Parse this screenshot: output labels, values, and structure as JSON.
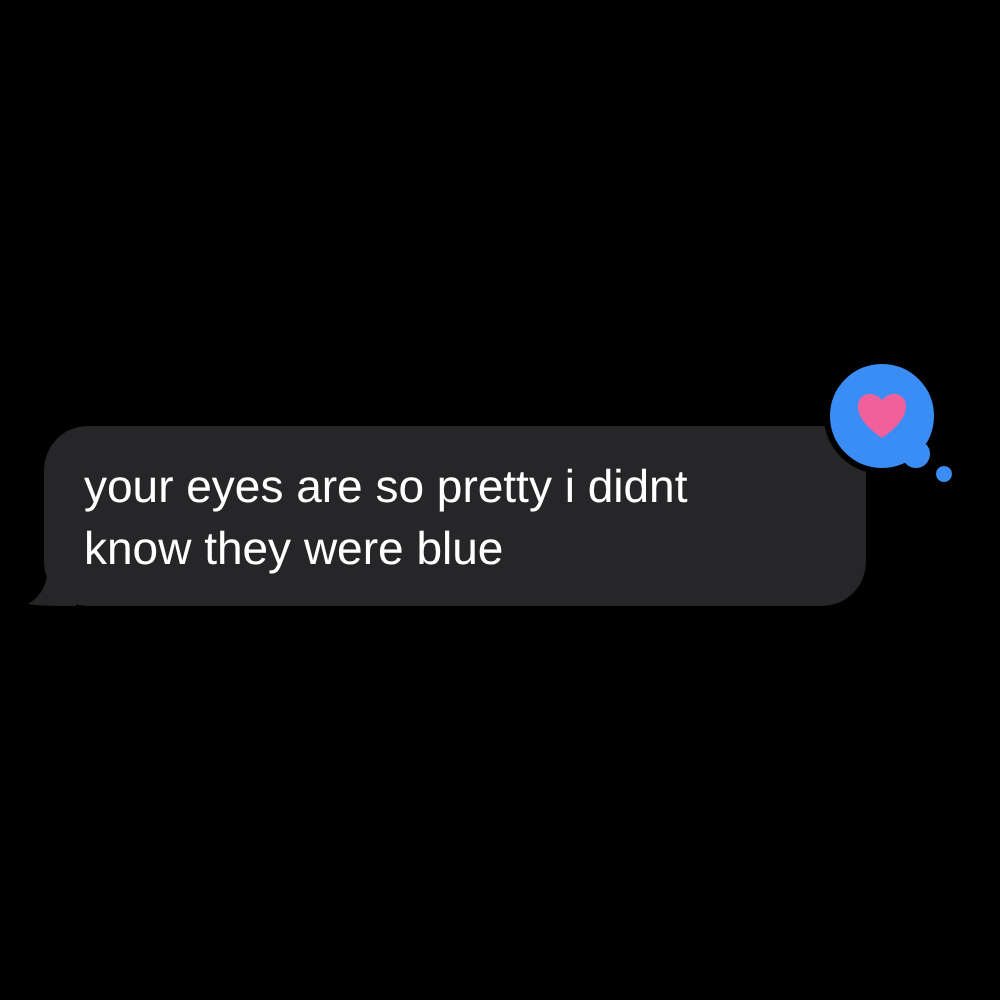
{
  "message": {
    "text": "your eyes are so pretty i didnt know they were blue",
    "reaction": {
      "kind": "heart"
    }
  }
}
